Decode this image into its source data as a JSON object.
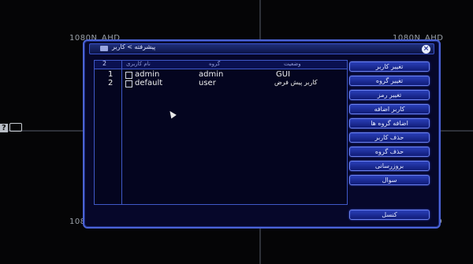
{
  "video": {
    "label_tl": "1080N_AHD",
    "label_tr": "1080N_AHD",
    "label_bl": "108",
    "label_br": "D",
    "ch_flag": "?"
  },
  "dialog": {
    "title": "پیشرفته > کاربر",
    "close": "×"
  },
  "table": {
    "count": "2",
    "headers": [
      "نام کاربری",
      "گروه",
      "وضعیت"
    ],
    "rows": [
      {
        "index": "1",
        "user": "admin",
        "group": "admin",
        "status": "GUI"
      },
      {
        "index": "2",
        "user": "default",
        "group": "user",
        "status": "کاربر پیش فرض"
      }
    ]
  },
  "buttons": [
    "تغییر کاربر",
    "تغییر گروه",
    "تغییر رمز",
    "کاربر اضافه",
    "اضافه گروه ها",
    "حذف کاربر",
    "حذف گروه",
    "بروزرسانی",
    "سوال"
  ],
  "exit_button": "کنسل",
  "colors": {
    "accent": "#4b63d6",
    "dialog_bg": "#06072a",
    "button_bg": "#1a2a98"
  }
}
